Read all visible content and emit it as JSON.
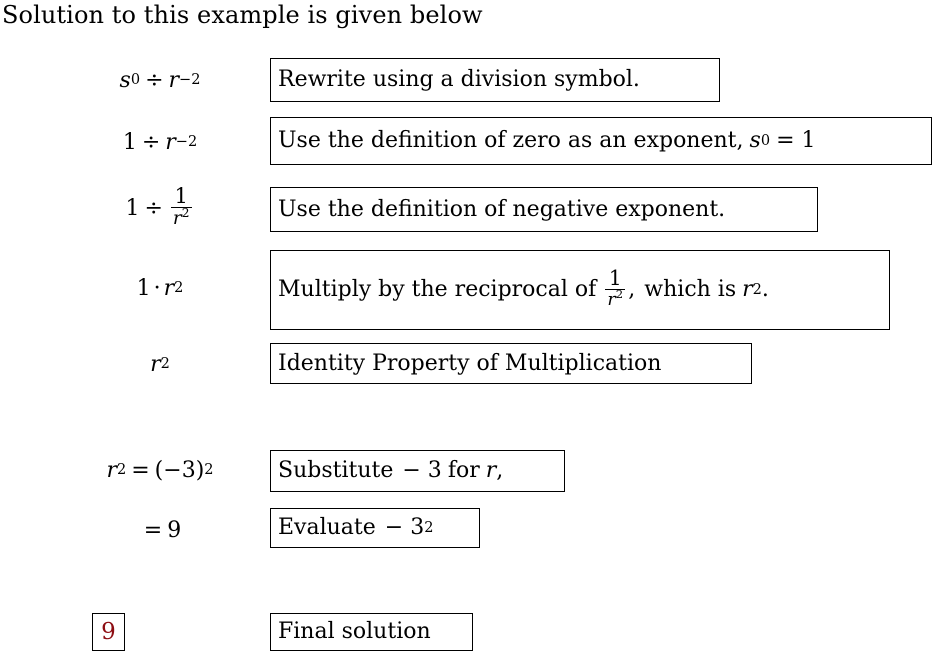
{
  "heading": "Solution to this example is given below",
  "steps": [
    {
      "expression_text": "s^0 ÷ r^-2",
      "base1": "s",
      "exp1": "0",
      "operator": "÷",
      "base2": "r",
      "exp2": "−2",
      "reason": "Rewrite using a division symbol."
    },
    {
      "expression_text": "1 ÷ r^-2",
      "lead": "1",
      "operator": "÷",
      "base2": "r",
      "exp2": "−2",
      "reason_prefix": "Use the definition of zero as an exponent,",
      "reason_math_base": "s",
      "reason_math_exp": "0",
      "reason_math_tail": "= 1",
      "reason_text": "Use the definition of zero as an exponent, s^0 = 1"
    },
    {
      "expression_text": "1 ÷ 1/r^2",
      "lead": "1",
      "operator": "÷",
      "frac_num": "1",
      "frac_den_base": "r",
      "frac_den_exp": "2",
      "reason": "Use the definition of negative exponent."
    },
    {
      "expression_text": "1 · r^2",
      "lead": "1",
      "operator": "·",
      "base2": "r",
      "exp2": "2",
      "reason_prefix": "Multiply by the reciprocal of",
      "reason_frac_num": "1",
      "reason_frac_den_base": "r",
      "reason_frac_den_exp": "2",
      "reason_mid": ",",
      "reason_suffix": "which is",
      "reason_tail_base": "r",
      "reason_tail_exp": "2",
      "reason_period": ".",
      "reason_text": "Multiply by the reciprocal of 1/r^2, which is r^2."
    },
    {
      "expression_text": "r^2",
      "base2": "r",
      "exp2": "2",
      "reason": "Identity Property of Multiplication"
    }
  ],
  "substitution": {
    "line1": {
      "expression_text": "r^2 = (−3)^2",
      "base": "r",
      "exp": "2",
      "equals": "=",
      "paren_open": "(",
      "value": "−3",
      "paren_close": ")",
      "outer_exp": "2",
      "reason_prefix": "Substitute",
      "reason_value": "− 3",
      "reason_suffix": "for",
      "reason_var": "r",
      "reason_comma": ",",
      "reason_text": "Substitute − 3 for r,"
    },
    "line2": {
      "expression_text": "= 9",
      "equals": "=",
      "value": "9",
      "reason_prefix": "Evaluate",
      "reason_value": "− 3",
      "reason_exp": "2",
      "reason_text": "Evaluate − 3^2"
    }
  },
  "final": {
    "answer": "9",
    "answer_color": "#8d0d12",
    "reason": "Final solution"
  }
}
